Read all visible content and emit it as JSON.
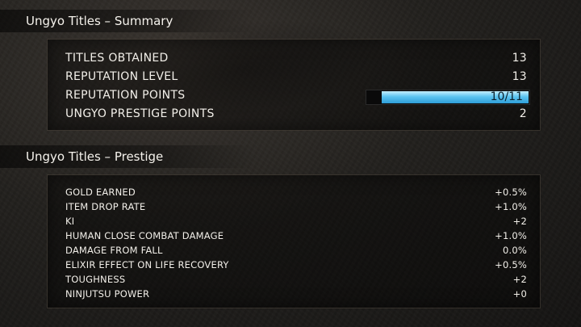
{
  "summary": {
    "title": "Ungyo Titles – Summary",
    "rows": [
      {
        "label": "TITLES OBTAINED",
        "value": "13"
      },
      {
        "label": "REPUTATION LEVEL",
        "value": "13"
      },
      {
        "label": "REPUTATION POINTS",
        "value": "10/11",
        "progress": 0.91
      },
      {
        "label": "UNGYO PRESTIGE POINTS",
        "value": "2"
      }
    ]
  },
  "prestige": {
    "title": "Ungyo Titles – Prestige",
    "rows": [
      {
        "label": "GOLD EARNED",
        "value": "+0.5%"
      },
      {
        "label": "ITEM DROP RATE",
        "value": "+1.0%"
      },
      {
        "label": "KI",
        "value": "+2"
      },
      {
        "label": "HUMAN CLOSE COMBAT DAMAGE",
        "value": "+1.0%"
      },
      {
        "label": "DAMAGE FROM FALL",
        "value": "0.0%"
      },
      {
        "label": "ELIXIR EFFECT ON LIFE RECOVERY",
        "value": "+0.5%"
      },
      {
        "label": "TOUGHNESS",
        "value": "+2"
      },
      {
        "label": "NINJUTSU POWER",
        "value": "+0"
      }
    ]
  },
  "colors": {
    "bar_fill": "#5cc4f0",
    "text": "#f2efe9"
  }
}
